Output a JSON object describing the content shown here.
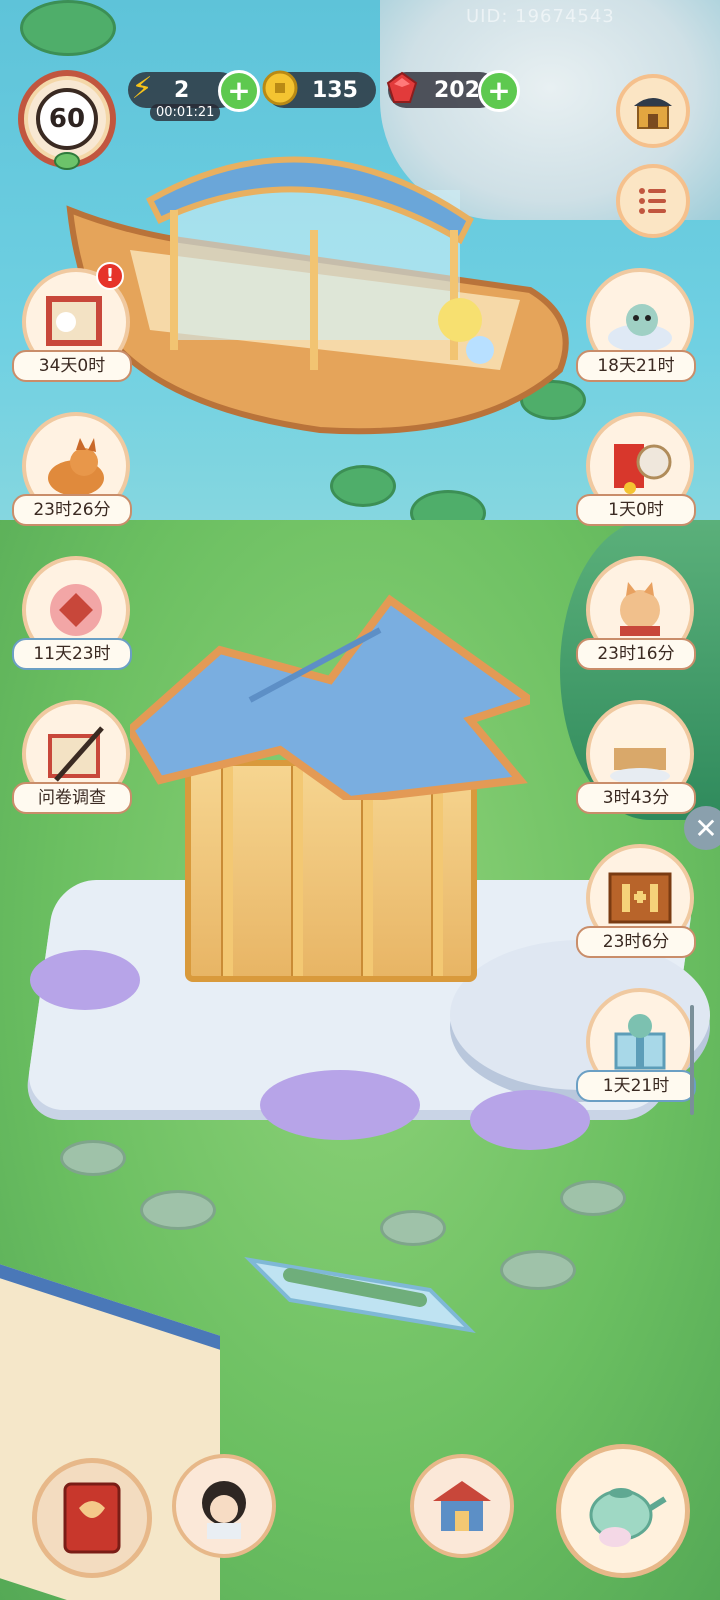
{
  "hud": {
    "level": "60",
    "energy": {
      "value": "2",
      "timer": "00:01:21"
    },
    "coins": {
      "value": "135"
    },
    "gems": {
      "value": "202"
    },
    "uid_text": "UID: 19674543"
  },
  "icons": {
    "energy": "lightning-icon",
    "coins": "coin-icon",
    "gems": "ruby-icon",
    "shop": "shop-icon",
    "menu": "list-menu-icon"
  },
  "events_left": [
    {
      "name": "event-letter",
      "label": "34天0时",
      "alert": "!"
    },
    {
      "name": "event-fox",
      "label": "23时26分"
    },
    {
      "name": "event-bells",
      "label": "11天23时"
    },
    {
      "name": "event-survey",
      "label": "问卷调查"
    }
  ],
  "events_right": [
    {
      "name": "event-cat-cloud",
      "label": "18天21时"
    },
    {
      "name": "event-envelope",
      "label": "1天0时"
    },
    {
      "name": "event-lucky-cat",
      "label": "23时16分"
    },
    {
      "name": "event-cake",
      "label": "3时43分"
    },
    {
      "name": "event-one-plus-one",
      "label": "23时6分"
    },
    {
      "name": "event-gift-cat",
      "label": "1天21时"
    }
  ],
  "colors": {
    "accent_red": "#c1563f",
    "plus_green": "#5ec94f",
    "label_border": "#c98d6a"
  }
}
